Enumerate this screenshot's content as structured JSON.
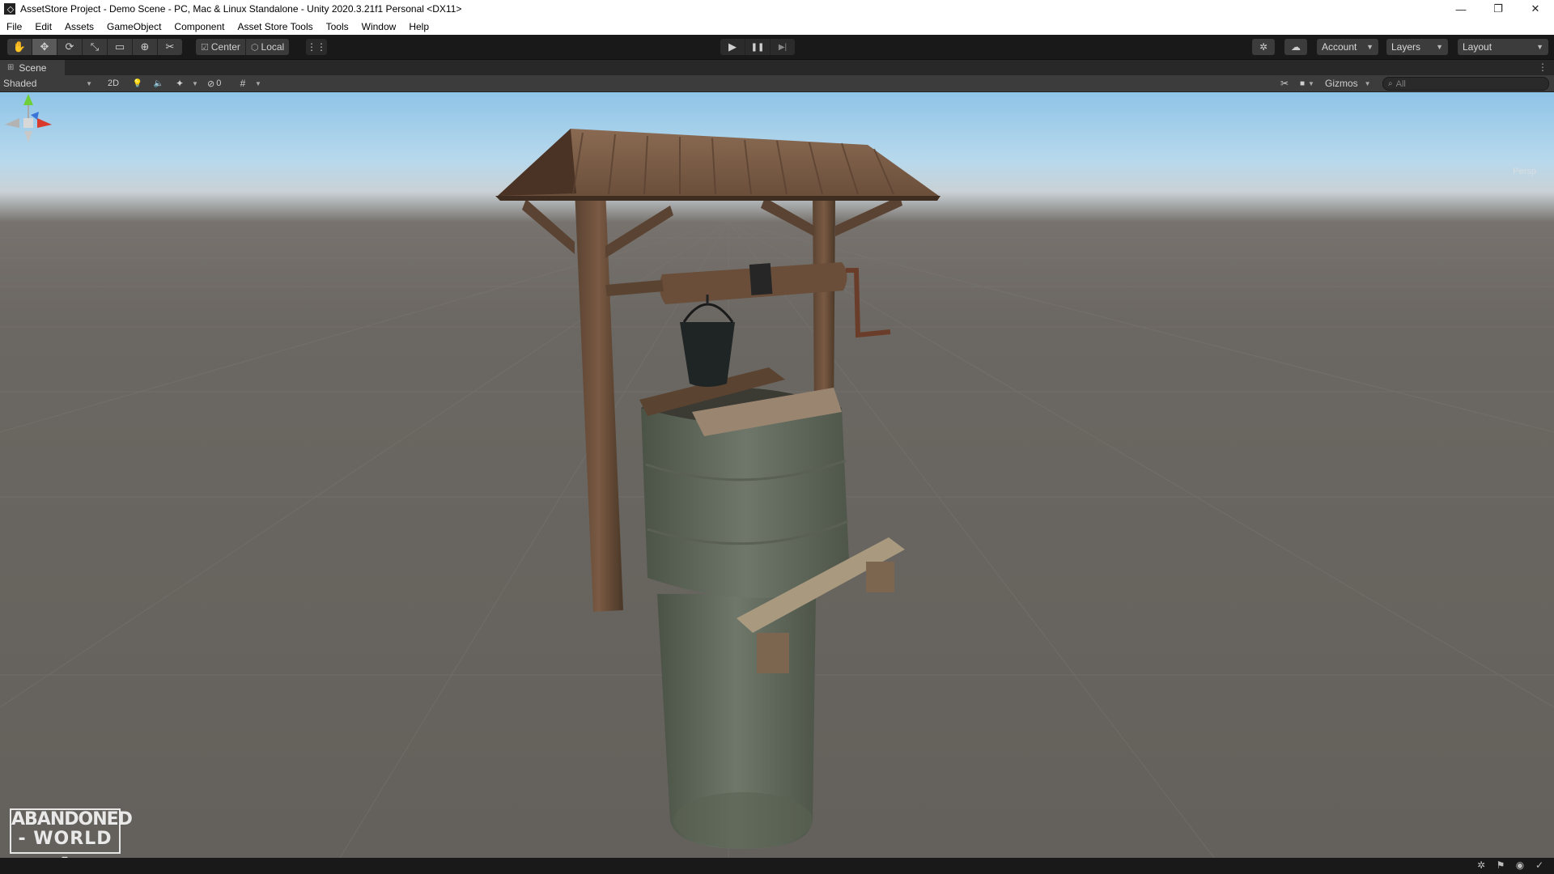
{
  "window": {
    "title": "AssetStore Project - Demo Scene - PC, Mac & Linux Standalone - Unity 2020.3.21f1 Personal <DX11>",
    "controls": [
      "—",
      "❐",
      "✕"
    ]
  },
  "menu": [
    "File",
    "Edit",
    "Assets",
    "GameObject",
    "Component",
    "Asset Store Tools",
    "Tools",
    "Window",
    "Help"
  ],
  "toolbar": {
    "tools": [
      {
        "icon": "hand-icon",
        "glyph": "✋"
      },
      {
        "icon": "move-icon",
        "glyph": "✥"
      },
      {
        "icon": "rotate-icon",
        "glyph": "⟳"
      },
      {
        "icon": "scale-icon",
        "glyph": "⤡"
      },
      {
        "icon": "rect-icon",
        "glyph": "▭"
      },
      {
        "icon": "transform-icon",
        "glyph": "⊕"
      },
      {
        "icon": "custom-tool-icon",
        "glyph": "✂"
      }
    ],
    "pivot_label": "Center",
    "pivot_icon": "☑",
    "rotation_label": "Local",
    "rotation_icon": "⬡",
    "snap_icon": "⋮⋮",
    "play_glyph": "▶",
    "pause_glyph": "❚❚",
    "step_glyph": "▶|",
    "collab_glyph": "✲",
    "cloud_glyph": "☁",
    "account_label": "Account",
    "layers_label": "Layers",
    "layout_label": "Layout"
  },
  "scene_tab": {
    "label": "Scene",
    "icon": "⊞",
    "menu_glyph": "⋮"
  },
  "scene_toolbar": {
    "draw_mode": "Shaded",
    "mode_2d": "2D",
    "light_glyph": "💡",
    "audio_glyph": "🔈",
    "fx_glyph": "✦",
    "hidden_count": "0",
    "hidden_glyph": "⊘",
    "grid_glyph": "#",
    "tools_glyph": "✂",
    "camera_glyph": "■",
    "gizmos_label": "Gizmos",
    "search_placeholder": "All",
    "search_glyph": "⌕"
  },
  "viewport": {
    "persp_label": "Persp"
  },
  "logo": {
    "line1": "ABANDONED",
    "line2": "- WORLD -"
  },
  "status_icons": [
    "✲",
    "⚑",
    "◉",
    "✓"
  ],
  "colors": {
    "sky_top": "#8fc4e8",
    "ground": "#64605b",
    "toolbar_bg": "#191919",
    "panel_bg": "#3c3c3c",
    "gizmo_x": "#d93a2c",
    "gizmo_y": "#6fcf3b",
    "gizmo_z": "#3a76d9"
  }
}
